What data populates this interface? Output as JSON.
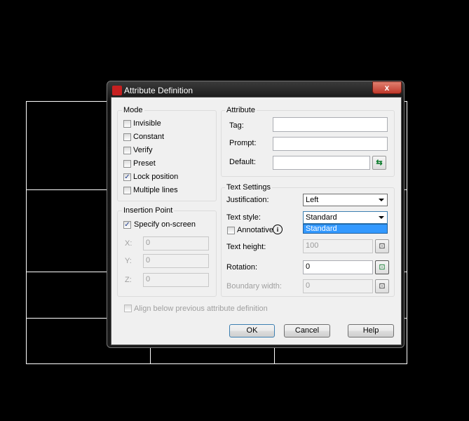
{
  "dialog": {
    "title": "Attribute Definition",
    "close": "x"
  },
  "mode": {
    "label": "Mode",
    "items": [
      {
        "label": "Invisible",
        "checked": false
      },
      {
        "label": "Constant",
        "checked": false
      },
      {
        "label": "Verify",
        "checked": false
      },
      {
        "label": "Preset",
        "checked": false
      },
      {
        "label": "Lock position",
        "checked": true
      },
      {
        "label": "Multiple lines",
        "checked": false
      }
    ]
  },
  "insertion": {
    "label": "Insertion Point",
    "specify": "Specify on-screen",
    "x_label": "X:",
    "y_label": "Y:",
    "z_label": "Z:",
    "x": "0",
    "y": "0",
    "z": "0"
  },
  "attribute": {
    "label": "Attribute",
    "tag_label": "Tag:",
    "prompt_label": "Prompt:",
    "default_label": "Default:",
    "tag": "",
    "prompt": "",
    "default": ""
  },
  "text_settings": {
    "label": "Text Settings",
    "justification_label": "Justification:",
    "justification": "Left",
    "style_label": "Text style:",
    "style": "Standard",
    "style_option": "Standard",
    "annotative": "Annotative",
    "info": "i",
    "height_label": "Text height:",
    "height": "100",
    "rotation_label": "Rotation:",
    "rotation": "0",
    "boundary_label": "Boundary width:",
    "boundary": "0"
  },
  "align": "Align below previous attribute definition",
  "buttons": {
    "ok": "OK",
    "cancel": "Cancel",
    "help": "Help"
  },
  "check_glyph": "✓",
  "colors": {
    "selection": "#3399ff"
  }
}
